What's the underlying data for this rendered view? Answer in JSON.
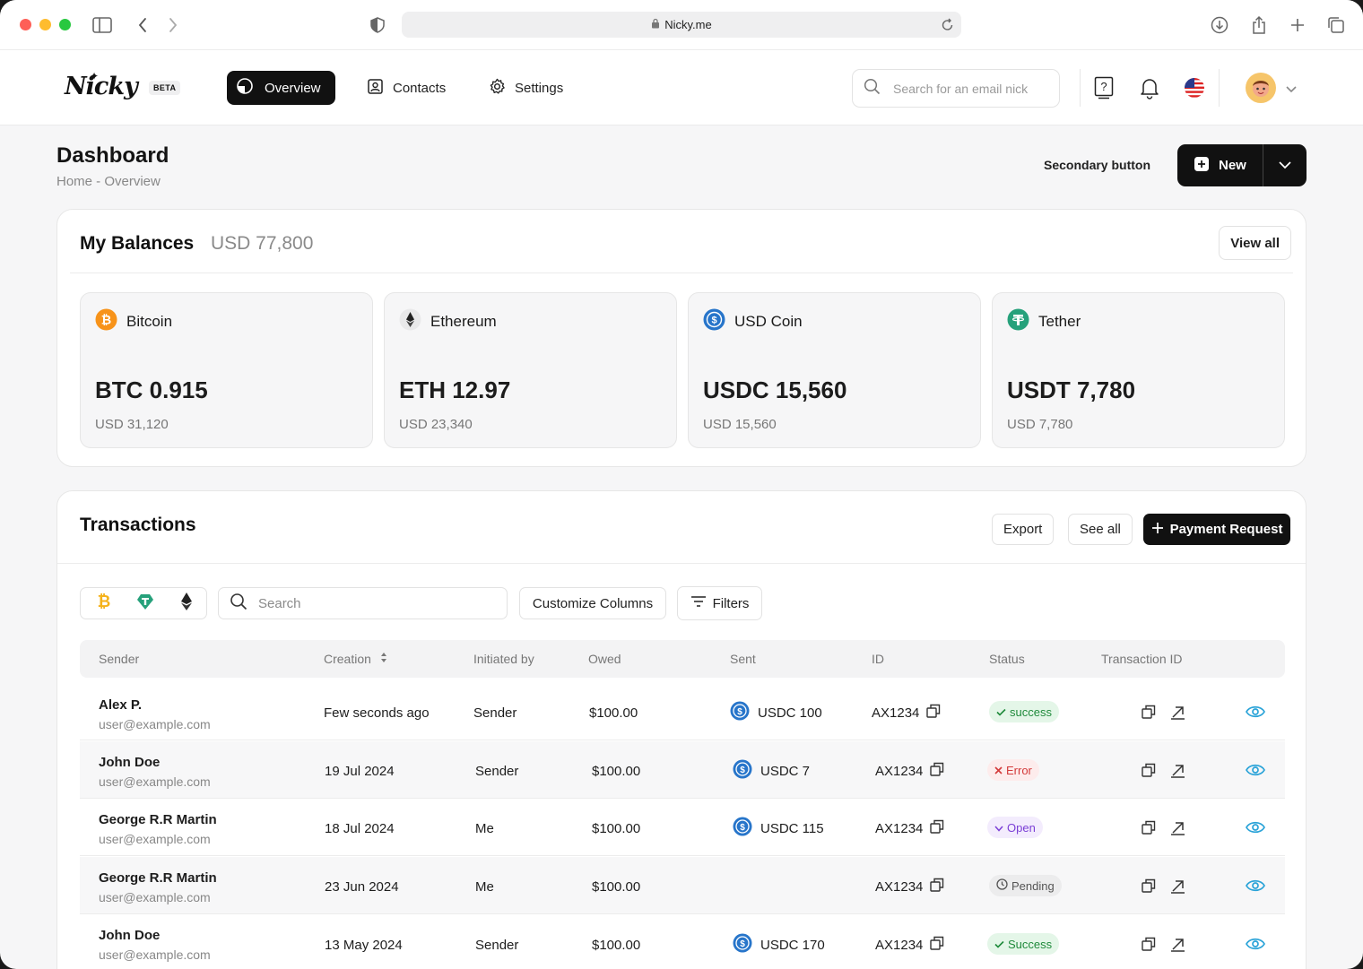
{
  "browser": {
    "url": "Nicky.me"
  },
  "header": {
    "logo": "Nicky",
    "beta": "BETA",
    "nav": {
      "overview": "Overview",
      "contacts": "Contacts",
      "settings": "Settings"
    },
    "search_placeholder": "Search for an email nick"
  },
  "page": {
    "title": "Dashboard",
    "breadcrumb": "Home - Overview",
    "secondary_button": "Secondary button",
    "new_button": "New"
  },
  "balances": {
    "title": "My Balances",
    "total": "USD 77,800",
    "view_all": "View all",
    "coins": [
      {
        "name": "Bitcoin",
        "amount": "BTC 0.915",
        "usd": "USD 31,120",
        "icon": "bitcoin-icon",
        "color": "#f7931a"
      },
      {
        "name": "Ethereum",
        "amount": "ETH 12.97",
        "usd": "USD 23,340",
        "icon": "ethereum-icon",
        "color": "#222222"
      },
      {
        "name": "USD Coin",
        "amount": "USDC 15,560",
        "usd": "USD 15,560",
        "icon": "usdc-icon",
        "color": "#2775ca"
      },
      {
        "name": "Tether",
        "amount": "USDT 7,780",
        "usd": "USD 7,780",
        "icon": "tether-icon",
        "color": "#26a17b"
      }
    ]
  },
  "transactions": {
    "title": "Transactions",
    "export": "Export",
    "see_all": "See all",
    "payment_request": "Payment Request",
    "search_placeholder": "Search",
    "customize_columns": "Customize Columns",
    "filters": "Filters",
    "columns": [
      "Sender",
      "Creation",
      "Initiated by",
      "Owed",
      "Sent",
      "ID",
      "Status",
      "Transaction ID"
    ],
    "rows": [
      {
        "name": "Alex P.",
        "email": "user@example.com",
        "creation": "Few seconds ago",
        "initiated": "Sender",
        "owed": "$100.00",
        "sent": "USDC 100",
        "id": "AX1234",
        "status": "success",
        "status_type": "success"
      },
      {
        "name": "John Doe",
        "email": "user@example.com",
        "creation": "19 Jul 2024",
        "initiated": "Sender",
        "owed": "$100.00",
        "sent": "USDC 7",
        "id": "AX1234",
        "status": "Error",
        "status_type": "error"
      },
      {
        "name": "George R.R Martin",
        "email": "user@example.com",
        "creation": "18 Jul 2024",
        "initiated": "Me",
        "owed": "$100.00",
        "sent": "USDC 115",
        "id": "AX1234",
        "status": "Open",
        "status_type": "open"
      },
      {
        "name": "George R.R Martin",
        "email": "user@example.com",
        "creation": "23 Jun 2024",
        "initiated": "Me",
        "owed": "$100.00",
        "sent": "",
        "id": "AX1234",
        "status": "Pending",
        "status_type": "pending"
      },
      {
        "name": "John Doe",
        "email": "user@example.com",
        "creation": "13 May 2024",
        "initiated": "Sender",
        "owed": "$100.00",
        "sent": "USDC 170",
        "id": "AX1234",
        "status": "Success",
        "status_type": "success"
      }
    ]
  },
  "colors": {
    "primary": "#111111",
    "eye": "#2aa3d8"
  }
}
